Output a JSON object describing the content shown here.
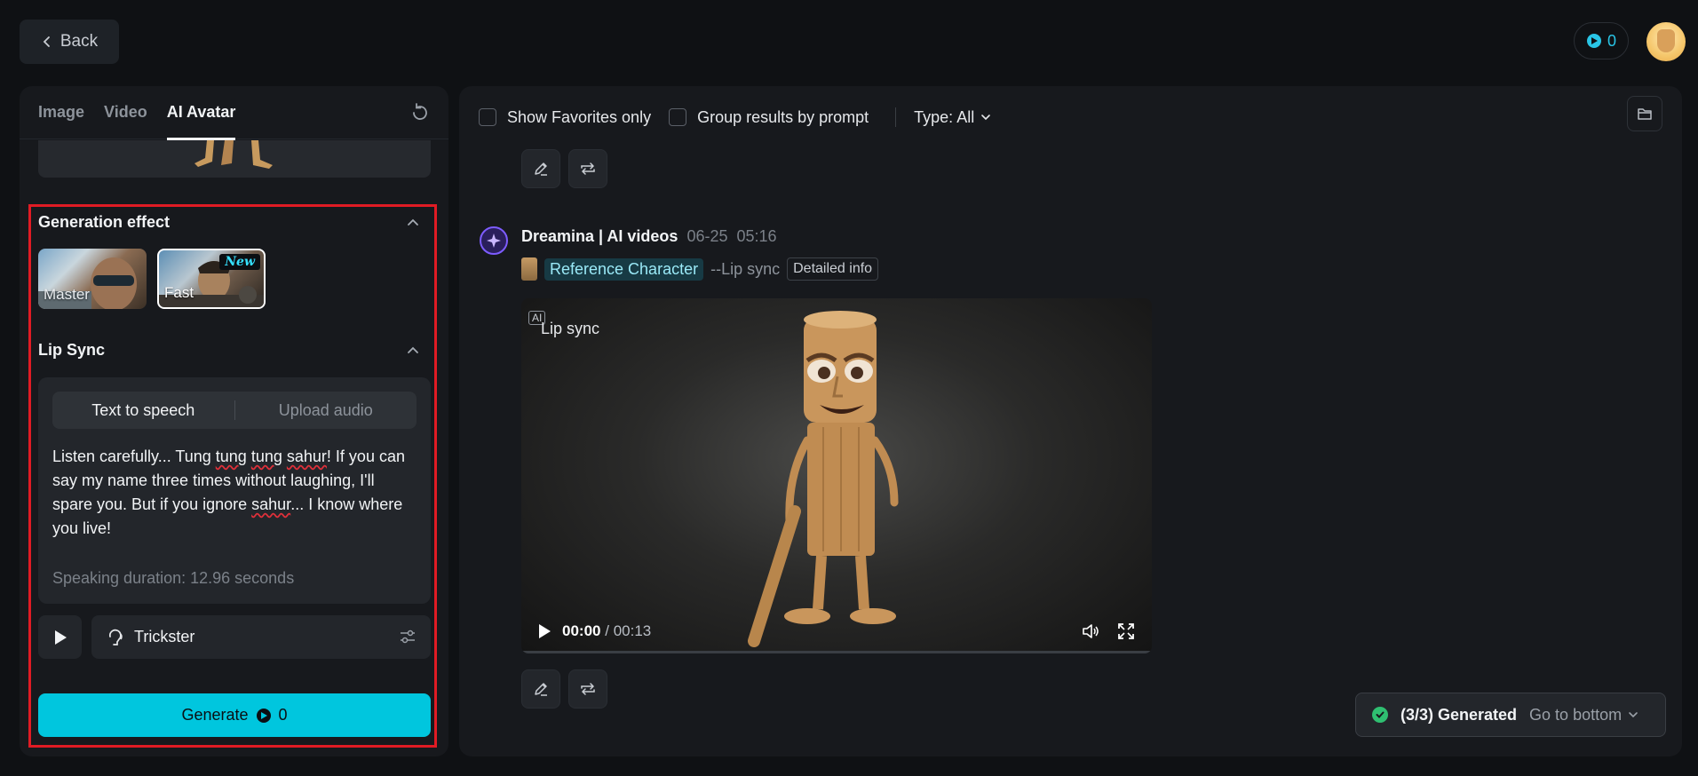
{
  "header": {
    "back_label": "Back",
    "credits": "0"
  },
  "left": {
    "tabs": [
      {
        "label": "Image"
      },
      {
        "label": "Video"
      },
      {
        "label": "AI Avatar"
      }
    ],
    "generation_effect": {
      "title": "Generation effect",
      "options": [
        {
          "label": "Master"
        },
        {
          "label": "Fast",
          "badge": "New"
        }
      ]
    },
    "lip_sync": {
      "title": "Lip Sync",
      "modes": [
        "Text to speech",
        "Upload audio"
      ],
      "text_parts": [
        "Listen carefully... Tung ",
        "tung",
        " ",
        "tung",
        " ",
        "sahur",
        "! If you can say my name three times without laughing, I'll spare you. But if you ignore ",
        "sahur",
        "... I know where you live!"
      ],
      "duration": "Speaking duration: 12.96 seconds",
      "voice": "Trickster"
    },
    "generate": {
      "label": "Generate",
      "cost": "0"
    }
  },
  "right": {
    "filters": {
      "favorites": "Show Favorites only",
      "group": "Group results by prompt",
      "type": "Type: All"
    },
    "post": {
      "author": "Dreamina | AI videos",
      "date": "06-25",
      "time": "05:16",
      "reference": "Reference Character",
      "mode": "--Lip sync",
      "detail": "Detailed info"
    },
    "video": {
      "ai_badge": "AI",
      "label": "Lip sync",
      "current": "00:00",
      "separator": "/",
      "total": "00:13",
      "progress": 0
    },
    "toast": {
      "status": "(3/3) Generated",
      "goto": "Go to bottom"
    }
  },
  "colors": {
    "accent": "#00c6de",
    "highlight_border": "#e01b24",
    "success": "#2fbf71",
    "brand_purple": "#7d5cff"
  }
}
